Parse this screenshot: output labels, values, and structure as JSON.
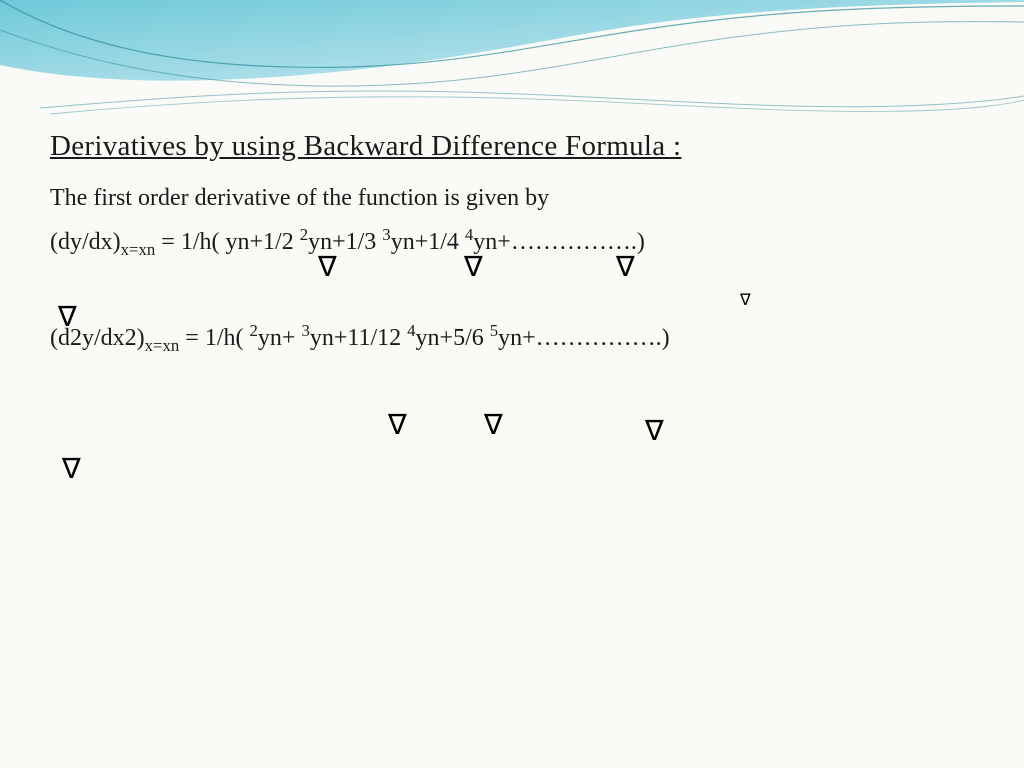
{
  "title": "Derivatives by using Backward Difference Formula :",
  "intro": "The first order derivative of the function is given by",
  "formula1": {
    "lhs_pre": "(dy/dx)",
    "lhs_sub": "x=xn",
    "eq": " = 1/h(  yn+1/2  ",
    "s2": "2",
    "p2": "yn+1/3  ",
    "s3": "3",
    "p3": "yn+1/4 ",
    "s4": "4",
    "p4": "yn+…………….)"
  },
  "formula2": {
    "lhs_pre": "(d2y/dx2)",
    "lhs_sub": "x=xn",
    "eq": " = 1/h(   ",
    "s2": "2",
    "p2": "yn+ ",
    "s3": "3",
    "p3": "yn+11/12  ",
    "s4": "4",
    "p4": "yn+5/6    ",
    "s5": "5",
    "p5": "yn+…………….)"
  },
  "nabla": "∇"
}
